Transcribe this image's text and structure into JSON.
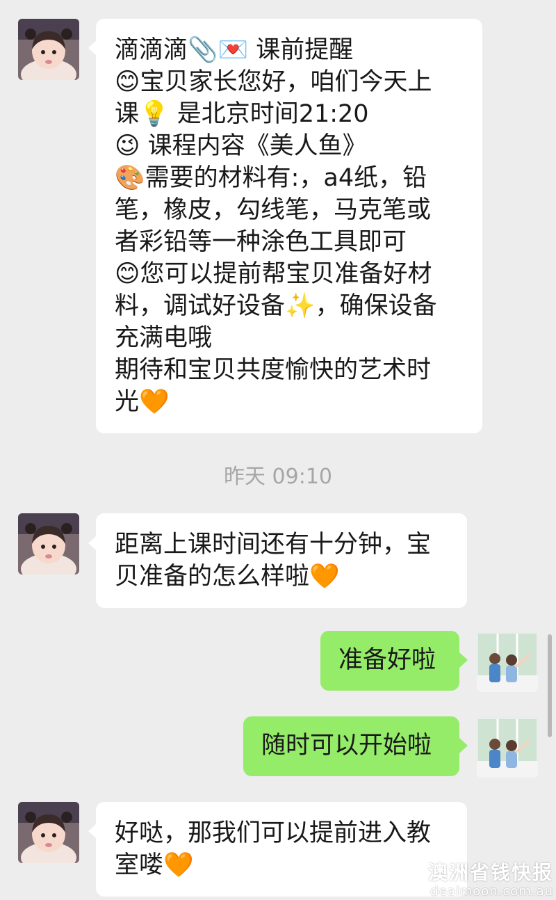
{
  "messages": [
    {
      "direction": "in",
      "avatar": "girl-avatar",
      "lines": [
        "滴滴滴📎💌 课前提醒",
        "😊宝贝家长您好，咱们今天上",
        "课💡 是北京时间21:20",
        "😉 课程内容《美人鱼》",
        "🎨需要的材料有:，a4纸，铅",
        "笔，橡皮，勾线笔，马克笔或",
        "者彩铅等一种涂色工具即可",
        "😊您可以提前帮宝贝准备好材",
        "料，调试好设备✨，确保设备",
        "充满电哦",
        "期待和宝贝共度愉快的艺术时",
        "光🧡"
      ]
    },
    {
      "direction": "in",
      "avatar": "girl-avatar",
      "lines": [
        "距离上课时间还有十分钟，宝",
        "贝准备的怎么样啦🧡"
      ]
    },
    {
      "direction": "out",
      "avatar": "kids-window-avatar",
      "lines": [
        "准备好啦"
      ]
    },
    {
      "direction": "out",
      "avatar": "kids-window-avatar",
      "lines": [
        "随时可以开始啦"
      ]
    },
    {
      "direction": "in",
      "avatar": "girl-avatar",
      "lines": [
        "好哒，那我们可以提前进入教",
        "室喽🧡"
      ]
    }
  ],
  "timestamp": "昨天 09:10",
  "watermark": {
    "main": "澳洲省钱快报",
    "sub": "dealmoon.com.au"
  },
  "colors": {
    "background": "#ededed",
    "incoming_bubble": "#ffffff",
    "outgoing_bubble": "#95ec69",
    "timestamp_text": "#a6a6a6"
  }
}
